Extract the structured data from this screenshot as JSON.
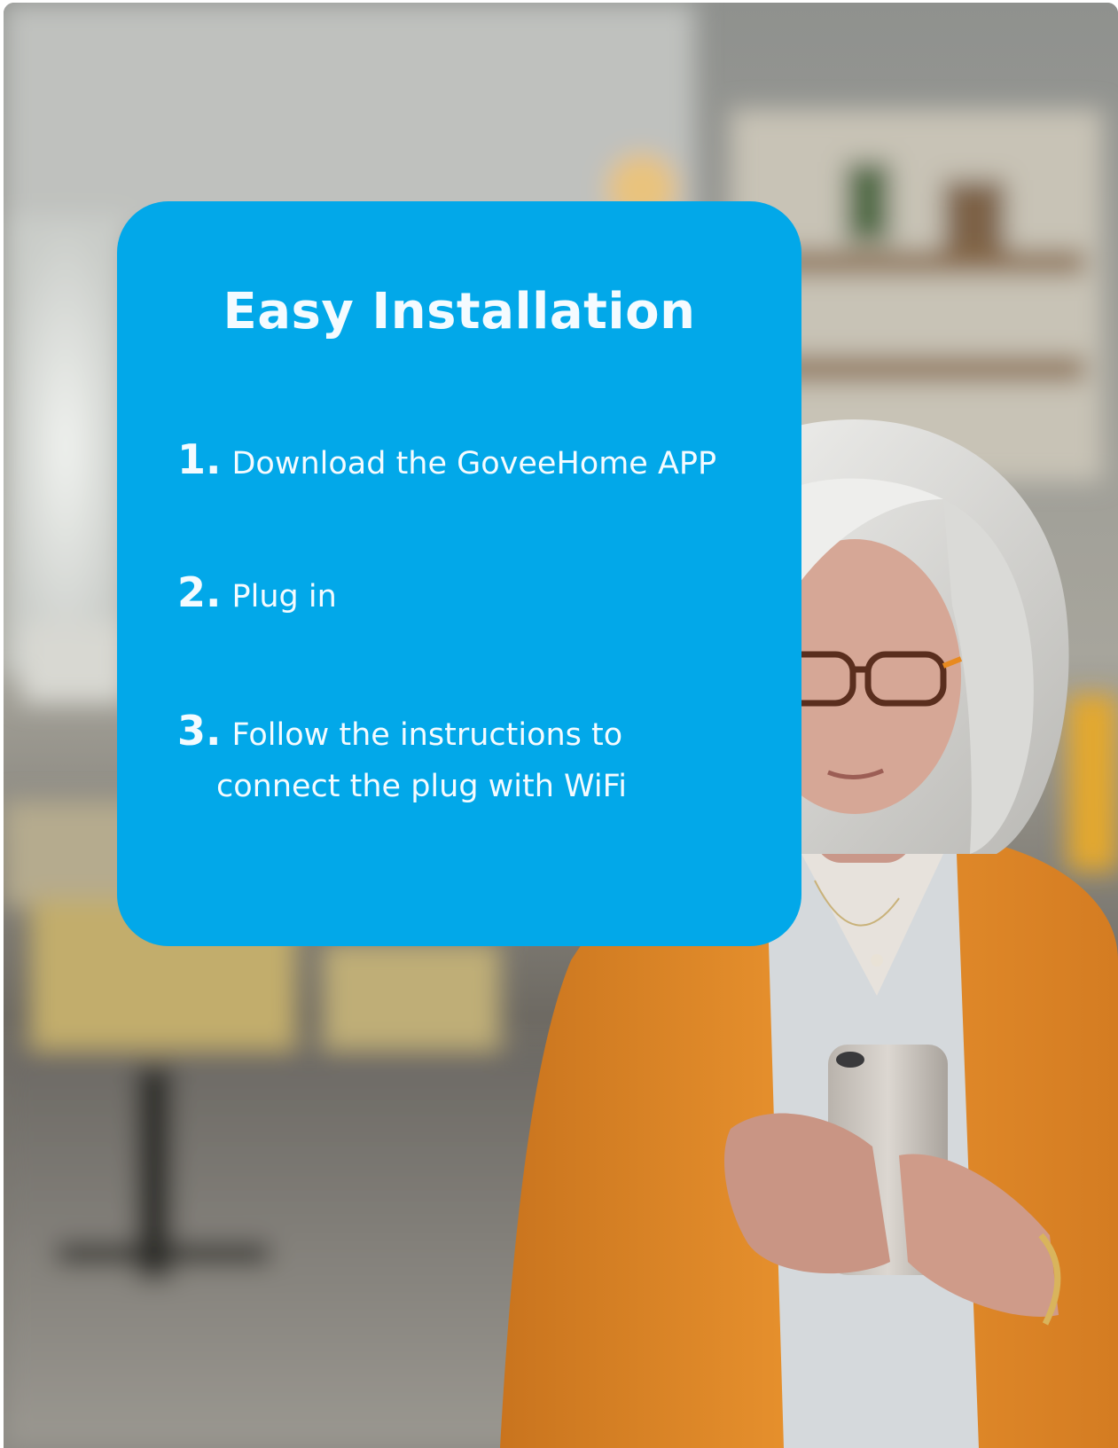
{
  "card": {
    "title": "Easy Installation",
    "color": "#02a8e9",
    "steps": [
      {
        "number": "1.",
        "text": "Download the GoveeHome APP"
      },
      {
        "number": "2.",
        "text": "Plug in"
      },
      {
        "number": "3.",
        "text": "Follow the instructions to",
        "text2": "connect the plug with WiFi"
      }
    ]
  },
  "photo": {
    "subject": "woman-using-smartphone",
    "colors": {
      "cardigan": "#e08c2c",
      "hair": "#e6e6e4",
      "phone": "#c9c5c0"
    }
  }
}
